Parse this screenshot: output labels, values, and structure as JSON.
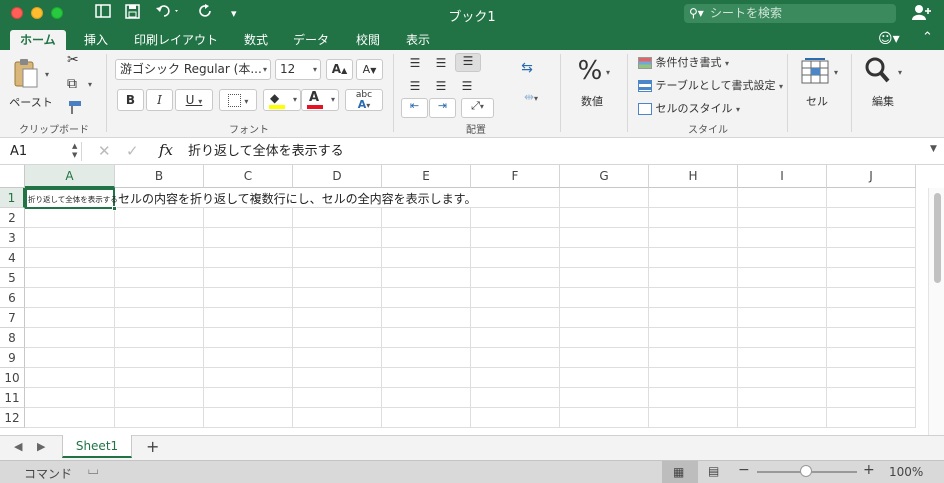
{
  "window": {
    "title": "ブック1"
  },
  "quick_access": {
    "icons": [
      "sidebar-icon",
      "save-icon",
      "undo-icon",
      "redo-icon",
      "customize-icon"
    ]
  },
  "search": {
    "placeholder": "シートを検索"
  },
  "tabs": [
    "ホーム",
    "挿入",
    "印刷レイアウト",
    "数式",
    "データ",
    "校閲",
    "表示"
  ],
  "active_tab": "ホーム",
  "ribbon": {
    "clipboard": {
      "paste_label": "ペースト",
      "group_label": "クリップボード"
    },
    "font": {
      "font_name": "游ゴシック Regular (本...",
      "font_size": "12",
      "bold": "B",
      "italic": "I",
      "underline": "U",
      "group_label": "フォント",
      "fill_color": "#ffff00",
      "font_color": "#e81123"
    },
    "alignment": {
      "group_label": "配置"
    },
    "number": {
      "symbol": "%",
      "label": "数値"
    },
    "styles": {
      "conditional": "条件付き書式",
      "table": "テーブルとして書式設定",
      "cell_styles": "セルのスタイル",
      "group_label": "スタイル"
    },
    "cells": {
      "label": "セル"
    },
    "editing": {
      "label": "編集"
    }
  },
  "formula_bar": {
    "name_box": "A1",
    "fx": "fx",
    "content": "折り返して全体を表示する"
  },
  "grid": {
    "columns": [
      "A",
      "B",
      "C",
      "D",
      "E",
      "F",
      "G",
      "H",
      "I",
      "J"
    ],
    "rows": [
      "1",
      "2",
      "3",
      "4",
      "5",
      "6",
      "7",
      "8",
      "9",
      "10",
      "11",
      "12"
    ],
    "a1_value": "折り返して全体を表示する",
    "b1_value": "セルの内容を折り返して複数行にし、セルの全内容を表示します。"
  },
  "sheets": [
    "Sheet1"
  ],
  "status": {
    "mode": "コマンド",
    "zoom": "100%"
  },
  "colors": {
    "accent": "#217346"
  }
}
